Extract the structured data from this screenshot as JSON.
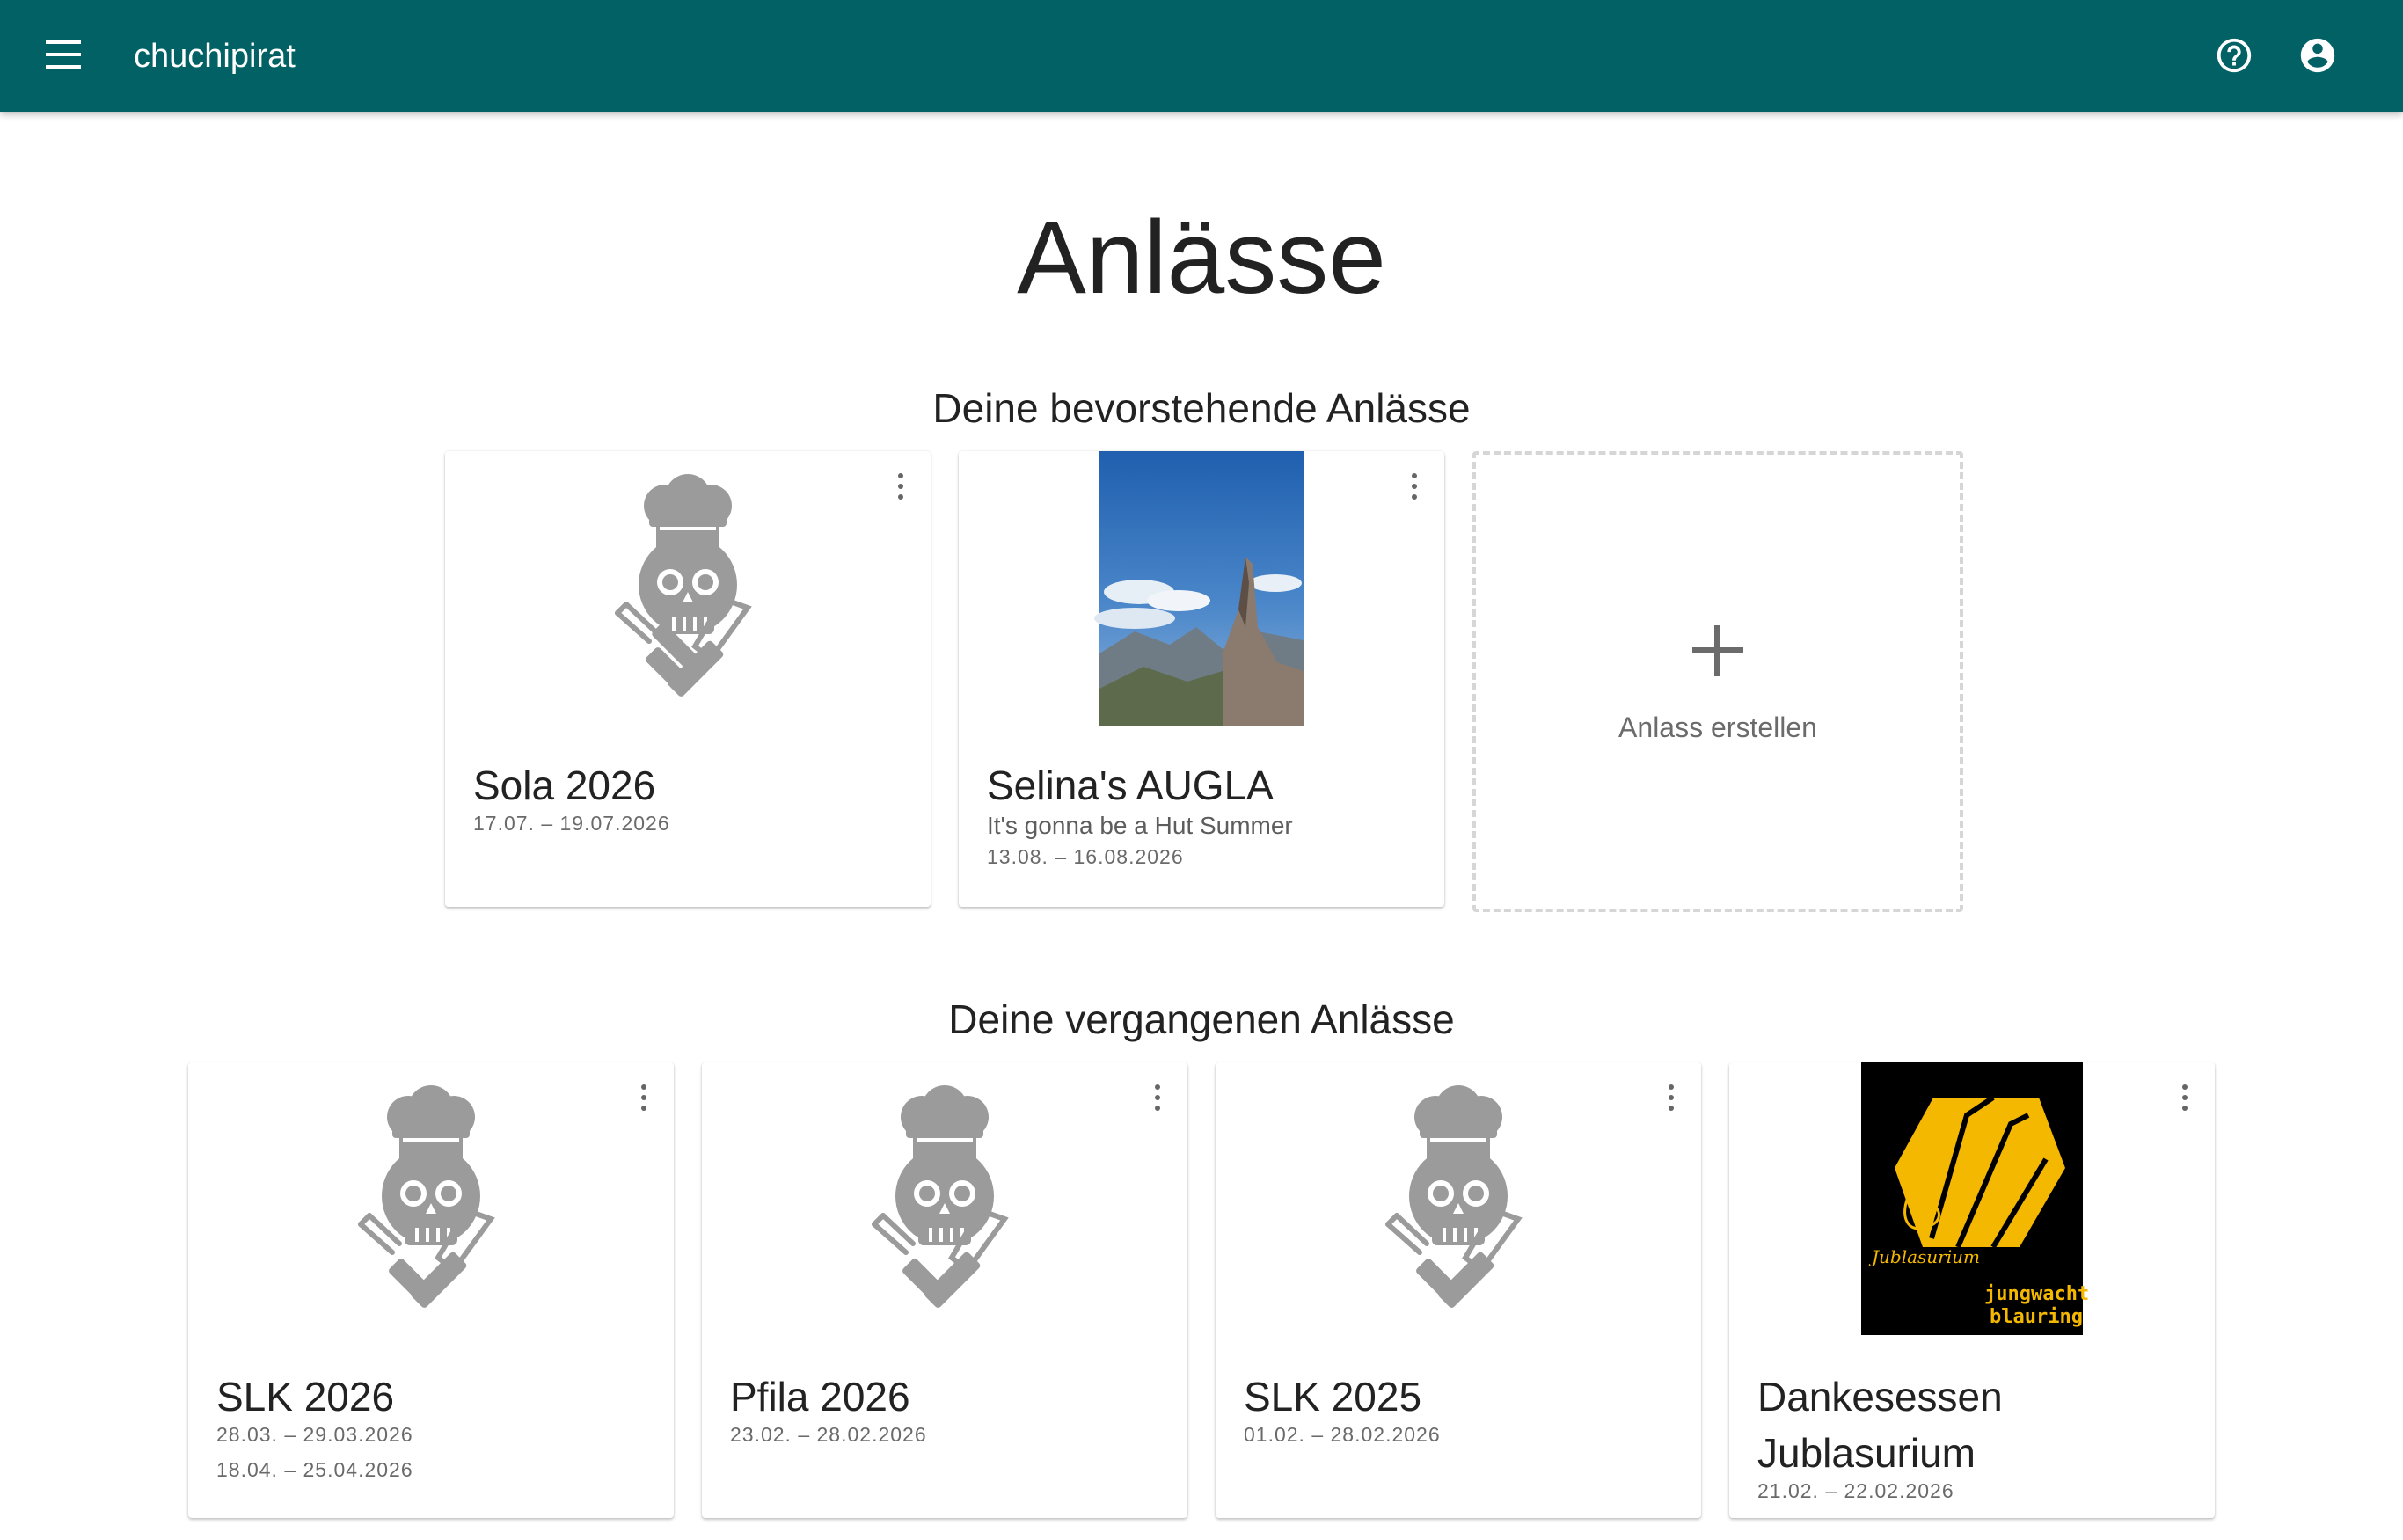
{
  "header": {
    "app_title": "chuchipirat",
    "menu_icon": "menu-icon",
    "help_icon": "help-circle-icon",
    "account_icon": "account-circle-icon",
    "bar_color": "#016165"
  },
  "page": {
    "title": "Anlässe"
  },
  "upcoming": {
    "title": "Deine bevorstehende Anlässe",
    "cards": [
      {
        "title": "Sola 2026",
        "dates": [
          "17.07. – 19.07.2026"
        ],
        "image": "chef-skull-placeholder"
      },
      {
        "title": "Selina's AUGLA",
        "subtitle": "It's gonna be a Hut Summer",
        "dates": [
          "13.08. – 16.08.2026"
        ],
        "image": "mountain-photo"
      }
    ],
    "create": {
      "label": "Anlass erstellen"
    }
  },
  "past": {
    "title": "Deine vergangenen Anlässe",
    "cards": [
      {
        "title": "SLK 2026",
        "dates": [
          "28.03. – 29.03.2026",
          "18.04. – 25.04.2026"
        ],
        "image": "chef-skull-placeholder"
      },
      {
        "title": "Pfila 2026",
        "dates": [
          "23.02. – 28.02.2026"
        ],
        "image": "chef-skull-placeholder"
      },
      {
        "title": "SLK 2025",
        "dates": [
          "01.02. – 28.02.2026"
        ],
        "image": "chef-skull-placeholder"
      },
      {
        "title": "Dankesessen Jublasurium",
        "dates": [
          "21.02. – 22.02.2026"
        ],
        "image": "jublasurium-logo",
        "logo_text": [
          "Jublasurium",
          "jungwacht",
          "blauring"
        ]
      }
    ]
  }
}
